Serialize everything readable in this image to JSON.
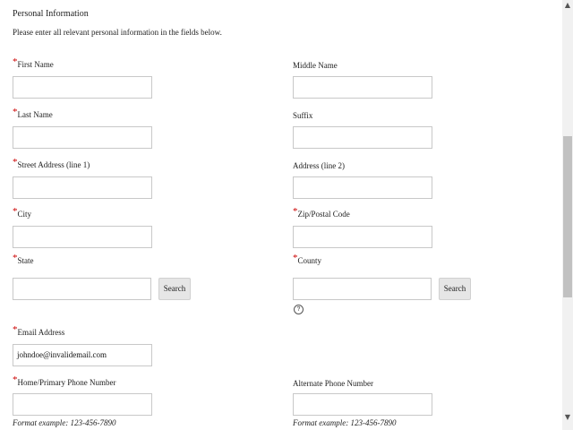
{
  "section": {
    "title": "Personal Information",
    "intro": "Please enter all relevant personal information in the fields below."
  },
  "required_mark": "*",
  "fields": {
    "first_name": {
      "label": "First Name",
      "value": ""
    },
    "middle_name": {
      "label": "Middle Name",
      "value": ""
    },
    "last_name": {
      "label": "Last Name",
      "value": ""
    },
    "suffix": {
      "label": "Suffix",
      "value": ""
    },
    "street1": {
      "label": "Street Address (line 1)",
      "value": ""
    },
    "street2": {
      "label": "Address (line 2)",
      "value": ""
    },
    "city": {
      "label": "City",
      "value": ""
    },
    "zip": {
      "label": "Zip/Postal Code",
      "value": ""
    },
    "state": {
      "label": "State",
      "value": ""
    },
    "county": {
      "label": "County",
      "value": ""
    },
    "email": {
      "label": "Email Address",
      "value": "johndoe@invalidemail.com"
    },
    "home_phone": {
      "label": "Home/Primary Phone Number",
      "value": ""
    },
    "alt_phone": {
      "label": "Alternate Phone Number",
      "value": ""
    }
  },
  "buttons": {
    "state_search": "Search",
    "county_search": "Search"
  },
  "help_glyph": "?",
  "format_hint": "Format example:  123-456-7890",
  "scroll": {
    "up_arrow": "▲",
    "down_arrow": "▼"
  }
}
